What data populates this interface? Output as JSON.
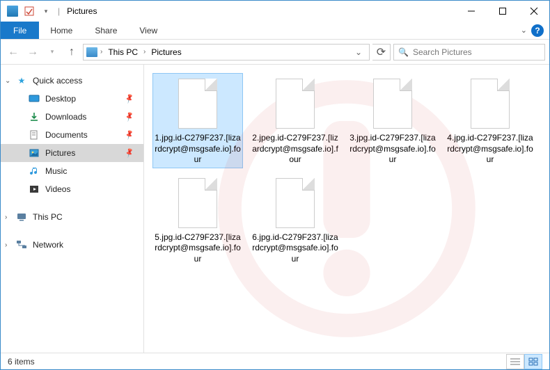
{
  "titlebar": {
    "title": "Pictures"
  },
  "menu": {
    "file": "File",
    "home": "Home",
    "share": "Share",
    "view": "View"
  },
  "breadcrumb": {
    "root": "This PC",
    "current": "Pictures"
  },
  "search": {
    "placeholder": "Search Pictures"
  },
  "sidebar": {
    "quick_access": "Quick access",
    "items": [
      {
        "label": "Desktop",
        "icon": "desktop",
        "pinned": true
      },
      {
        "label": "Downloads",
        "icon": "downloads",
        "pinned": true
      },
      {
        "label": "Documents",
        "icon": "documents",
        "pinned": true
      },
      {
        "label": "Pictures",
        "icon": "pictures",
        "pinned": true,
        "selected": true
      },
      {
        "label": "Music",
        "icon": "music",
        "pinned": false
      },
      {
        "label": "Videos",
        "icon": "videos",
        "pinned": false
      }
    ],
    "this_pc": "This PC",
    "network": "Network"
  },
  "files": [
    {
      "name": "1.jpg.id-C279F237.[lizardcrypt@msgsafe.io].four",
      "selected": true
    },
    {
      "name": "2.jpeg.id-C279F237.[lizardcrypt@msgsafe.io].four",
      "selected": false
    },
    {
      "name": "3.jpg.id-C279F237.[lizardcrypt@msgsafe.io].four",
      "selected": false
    },
    {
      "name": "4.jpg.id-C279F237.[lizardcrypt@msgsafe.io].four",
      "selected": false
    },
    {
      "name": "5.jpg.id-C279F237.[lizardcrypt@msgsafe.io].four",
      "selected": false
    },
    {
      "name": "6.jpg.id-C279F237.[lizardcrypt@msgsafe.io].four",
      "selected": false
    }
  ],
  "status": {
    "count": "6 items"
  }
}
